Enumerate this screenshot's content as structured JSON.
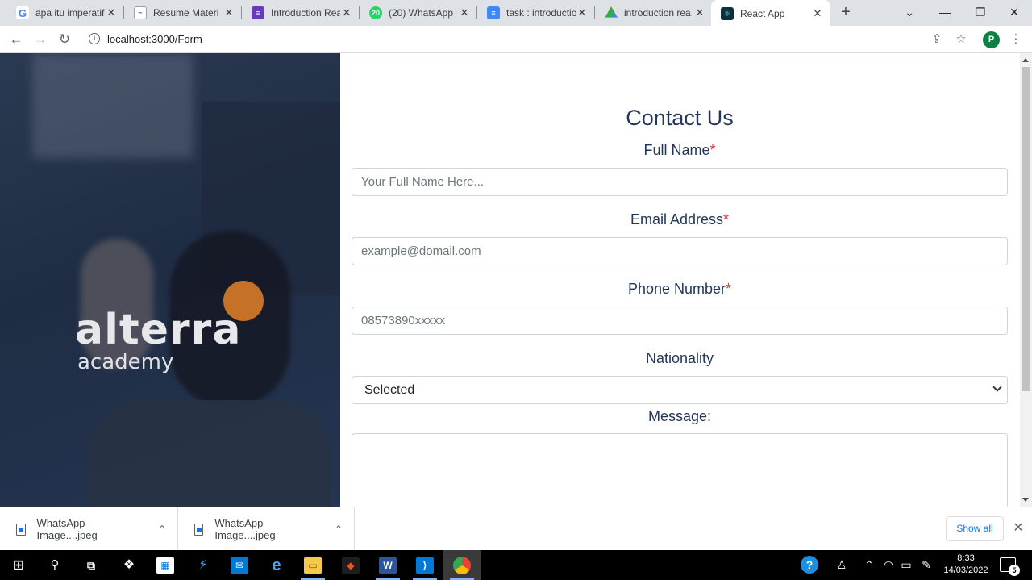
{
  "browser": {
    "tabs": [
      {
        "title": "apa itu imperatif",
        "icon": "google-icon",
        "color": "#4285f4"
      },
      {
        "title": "Resume Materi",
        "icon": "page-icon",
        "color": "#5f6368"
      },
      {
        "title": "Introduction Rea",
        "icon": "forms-icon",
        "color": "#673ab7"
      },
      {
        "title": "(20) WhatsApp",
        "icon": "whatsapp-icon",
        "color": "#25d366"
      },
      {
        "title": "task : introductio",
        "icon": "docs-icon",
        "color": "#4285f4"
      },
      {
        "title": "introduction rea",
        "icon": "drive-icon",
        "color": "#fbbc04"
      },
      {
        "title": "React App",
        "icon": "react-icon",
        "color": "#0f2f3a"
      }
    ],
    "new_tab": "+",
    "url": "localhost:3000/Form",
    "profile_initial": "P"
  },
  "hero": {
    "logo_main": "alterra",
    "logo_sub": "academy"
  },
  "form": {
    "title": "Contact Us",
    "required_mark": "*",
    "full_name": {
      "label": "Full Name",
      "placeholder": "Your Full Name Here..."
    },
    "email": {
      "label": "Email Address",
      "placeholder": "example@domail.com"
    },
    "phone": {
      "label": "Phone Number",
      "placeholder": "08573890xxxxx"
    },
    "nationality": {
      "label": "Nationality",
      "selected": "Selected"
    },
    "message": {
      "label": "Message:"
    }
  },
  "downloads": {
    "items": [
      {
        "name": "WhatsApp Image....jpeg"
      },
      {
        "name": "WhatsApp Image....jpeg"
      }
    ],
    "show_all": "Show all"
  },
  "taskbar": {
    "apps": [
      "start",
      "search",
      "task-view",
      "dropbox",
      "store",
      "powershell",
      "mail",
      "edge",
      "file-explorer",
      "figma",
      "word",
      "vscode",
      "chrome"
    ],
    "time": "8:33",
    "date": "14/03/2022",
    "notification_count": "5"
  }
}
